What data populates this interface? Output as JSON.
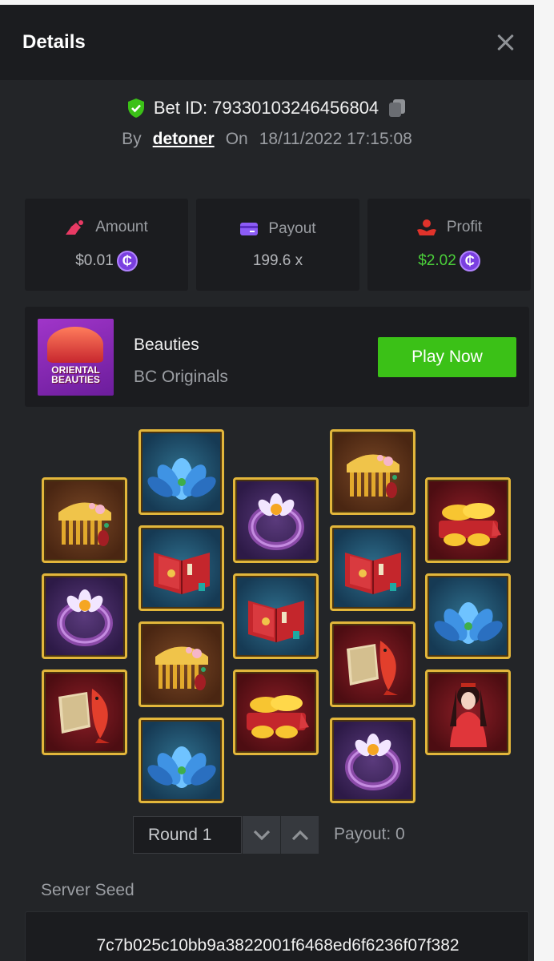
{
  "header": {
    "title": "Details"
  },
  "bet": {
    "id_label": "Bet ID: 79330103246456804",
    "by_label": "By",
    "user": "detoner",
    "on_label": "On",
    "datetime": "18/11/2022 17:15:08"
  },
  "stats": [
    {
      "label": "Amount",
      "value": "$0.01",
      "icon": "amount-icon",
      "color": "#e83a64"
    },
    {
      "label": "Payout",
      "value": "199.6 x",
      "icon": "payout-card-icon",
      "color": "#8c5cf6"
    },
    {
      "label": "Profit",
      "value": "$2.02",
      "icon": "profit-icon",
      "color": "#e0332b"
    }
  ],
  "currency_symbol": "₵",
  "game": {
    "name": "Beauties",
    "provider": "BC Originals",
    "play_label": "Play Now",
    "thumb_text": "ORIENTAL BEAUTIES"
  },
  "reels": [
    [
      "comb",
      "ring",
      "koi"
    ],
    [
      "lotus",
      "book",
      "comb",
      "lotus"
    ],
    [
      "ring",
      "book",
      "gold"
    ],
    [
      "comb",
      "book",
      "koi",
      "ring"
    ],
    [
      "gold",
      "lotus",
      "beauty"
    ]
  ],
  "round": {
    "label": "Round 1",
    "payout_text": "Payout: 0"
  },
  "seed": {
    "label": "Server Seed",
    "value": "7c7b025c10bb9a3822001f6468ed6f6236f07f382"
  },
  "colors": {
    "panel": "#232528",
    "card": "#1b1c1f",
    "accent_green": "#3bc117",
    "tile_border": "#e2b63b"
  }
}
